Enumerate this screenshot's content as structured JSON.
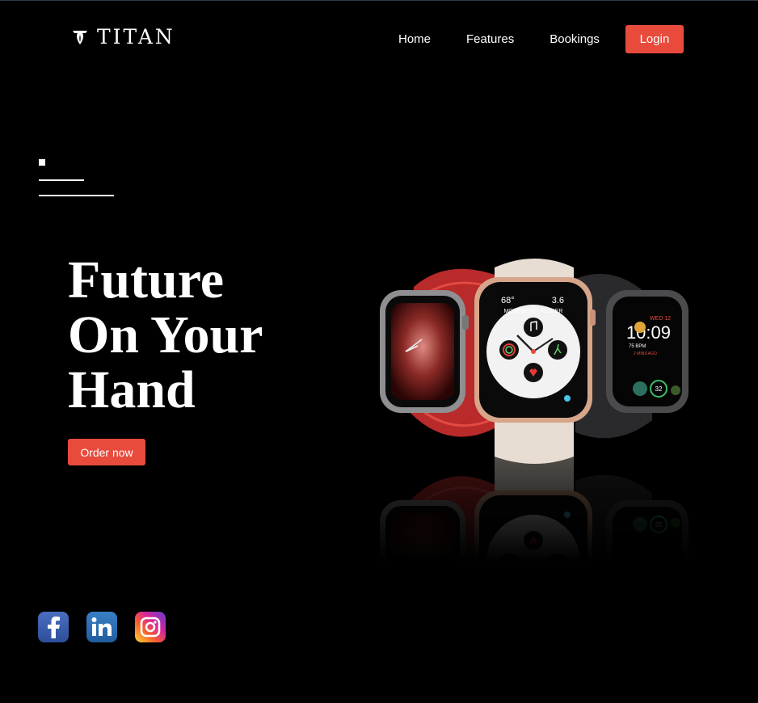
{
  "brand": {
    "name": "TITAN"
  },
  "nav": {
    "items": [
      {
        "label": "Home"
      },
      {
        "label": "Features"
      },
      {
        "label": "Bookings"
      }
    ],
    "login_label": "Login"
  },
  "hero": {
    "title": "Future\nOn Your\nHand",
    "cta_label": "Order now"
  },
  "watches": {
    "center": {
      "top_left": "68°",
      "top_right": "3.6",
      "ring_text": "MOVEMENT · HOZIER",
      "uv": "UVI"
    },
    "right": {
      "day": "WED 12",
      "time": "10:09",
      "bpm": "75 BPM",
      "mins": "2 MINS AGO",
      "stat": "32"
    }
  },
  "colors": {
    "accent": "#e84b3c",
    "background": "#000000"
  },
  "social": [
    {
      "name": "facebook-icon"
    },
    {
      "name": "linkedin-icon"
    },
    {
      "name": "instagram-icon"
    }
  ]
}
